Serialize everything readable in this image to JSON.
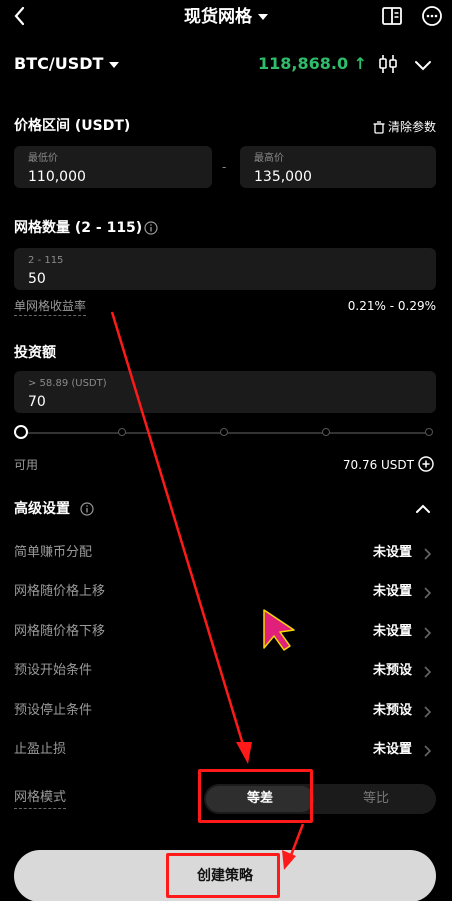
{
  "header": {
    "title": "现货网格",
    "back_icon": "chevron-left-icon",
    "book_icon": "book-icon",
    "more_icon": "more-icon"
  },
  "pair": {
    "symbol": "BTC/USDT",
    "price": "118,868.0 ↑",
    "price_color": "#2ebd6b"
  },
  "price_range": {
    "label": "价格区间 (USDT)",
    "clear_label": "清除参数",
    "low": {
      "placeholder": "最低价",
      "value": "110,000"
    },
    "separator": "-",
    "high": {
      "placeholder": "最高价",
      "value": "135,000"
    }
  },
  "grid_count": {
    "label": "网格数量 (2 - 115)",
    "placeholder": "2 - 115",
    "value": "50",
    "profit_label": "单网格收益率",
    "profit_value": "0.21% - 0.29%"
  },
  "investment": {
    "label": "投资额",
    "placeholder": "> 58.89 (USDT)",
    "value": "70",
    "slider_fraction": 0,
    "available_label": "可用",
    "available_value": "70.76 USDT"
  },
  "advanced": {
    "label": "高级设置",
    "rows": [
      {
        "label": "简单赚币分配",
        "value": "未设置"
      },
      {
        "label": "网格随价格上移",
        "value": "未设置"
      },
      {
        "label": "网格随价格下移",
        "value": "未设置"
      },
      {
        "label": "预设开始条件",
        "value": "未预设"
      },
      {
        "label": "预设停止条件",
        "value": "未预设"
      },
      {
        "label": "止盈止损",
        "value": "未设置"
      }
    ]
  },
  "grid_mode": {
    "label": "网格模式",
    "options": [
      "等差",
      "等比"
    ],
    "selected": "等差"
  },
  "create_button": "创建策略",
  "annotation_color": "#ff1a1a"
}
